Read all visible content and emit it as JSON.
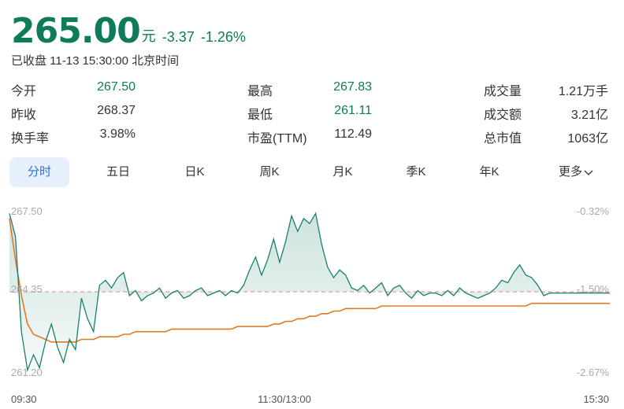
{
  "header": {
    "price": "265.00",
    "unit": "元",
    "change": "-3.37",
    "change_pct": "-1.26%",
    "status": "已收盘 11-13 15:30:00 北京时间"
  },
  "stats": {
    "open": {
      "label": "今开",
      "value": "267.50"
    },
    "prev_close": {
      "label": "昨收",
      "value": "268.37"
    },
    "turnover_rate": {
      "label": "换手率",
      "value": "3.98%"
    },
    "high": {
      "label": "最高",
      "value": "267.83"
    },
    "low": {
      "label": "最低",
      "value": "261.11"
    },
    "pe_ttm": {
      "label": "市盈(TTM)",
      "value": "112.49"
    },
    "volume": {
      "label": "成交量",
      "value": "1.21万手"
    },
    "amount": {
      "label": "成交额",
      "value": "3.21亿"
    },
    "market_cap": {
      "label": "总市值",
      "value": "1063亿"
    }
  },
  "tabs": [
    {
      "label": "分时"
    },
    {
      "label": "五日"
    },
    {
      "label": "日K"
    },
    {
      "label": "周K"
    },
    {
      "label": "月K"
    },
    {
      "label": "季K"
    },
    {
      "label": "年K"
    },
    {
      "label": "更多"
    }
  ],
  "colors": {
    "accent_green": "#0f7b5a",
    "price_line": "#1a7f6b",
    "avg_line": "#e07a24",
    "ref_line": "#e99a9a",
    "tab_active_bg": "#e7f1fd",
    "tab_active_text": "#2f6fd6"
  },
  "chart_data": {
    "type": "line",
    "ylim": [
      261.2,
      267.5
    ],
    "y_tick_labels": [
      "267.50",
      "264.35",
      "261.20"
    ],
    "pct_tick_labels": [
      "-0.32%",
      "-1.50%",
      "-2.67%"
    ],
    "reference_price": 264.35,
    "x_tick_labels": [
      "09:30",
      "11:30/13:00",
      "15:30"
    ],
    "x_range": [
      0,
      100
    ],
    "series": [
      {
        "x": [
          0,
          1,
          2,
          3,
          4,
          5,
          6,
          7,
          8,
          9,
          10,
          11,
          12,
          13,
          14,
          15,
          16,
          17,
          18,
          19,
          20,
          21,
          22,
          23,
          24,
          25,
          26,
          27,
          28,
          29,
          30,
          31,
          32,
          33,
          34,
          35,
          36,
          37,
          38,
          39,
          40,
          41,
          42,
          43,
          44,
          45,
          46,
          47,
          48,
          49,
          50,
          51,
          52,
          53,
          54,
          55,
          56,
          57,
          58,
          59,
          60,
          61,
          62,
          63,
          64,
          65,
          66,
          67,
          68,
          69,
          70,
          71,
          72,
          73,
          74,
          75,
          76,
          77,
          78,
          79,
          80,
          81,
          82,
          83,
          84,
          85,
          86,
          87,
          88,
          89,
          90,
          91,
          92,
          93,
          94,
          95,
          96,
          97,
          98,
          99,
          100
        ],
        "values": [
          267.4,
          266.5,
          262.8,
          261.3,
          261.9,
          261.4,
          262.4,
          263.1,
          262.2,
          261.6,
          262.5,
          262.1,
          264.1,
          263.3,
          262.8,
          264.6,
          264.8,
          264.5,
          264.9,
          265.1,
          264.2,
          264.4,
          264.0,
          264.2,
          264.3,
          264.5,
          264.1,
          264.3,
          264.4,
          264.1,
          264.2,
          264.4,
          264.5,
          264.2,
          264.3,
          264.4,
          264.2,
          264.4,
          264.3,
          264.6,
          265.2,
          265.7,
          265.0,
          265.6,
          266.4,
          265.5,
          266.3,
          267.3,
          266.7,
          267.2,
          267.0,
          267.4,
          266.2,
          265.3,
          264.9,
          265.2,
          265.0,
          264.5,
          264.4,
          264.6,
          264.3,
          264.5,
          264.7,
          264.2,
          264.5,
          264.6,
          264.3,
          264.1,
          264.4,
          264.2,
          264.3,
          264.3,
          264.2,
          264.4,
          264.2,
          264.5,
          264.3,
          264.2,
          264.1,
          264.2,
          264.3,
          264.5,
          264.8,
          264.7,
          265.1,
          265.4,
          265.0,
          264.9,
          264.6,
          264.2,
          264.3,
          264.3,
          264.3,
          264.3,
          264.3,
          264.3,
          264.3,
          264.3,
          264.3,
          264.3,
          264.3
        ]
      },
      {
        "x": [
          0,
          1,
          2,
          3,
          4,
          5,
          6,
          7,
          8,
          9,
          10,
          11,
          12,
          13,
          14,
          15,
          16,
          17,
          18,
          19,
          20,
          21,
          22,
          23,
          24,
          25,
          26,
          27,
          28,
          29,
          30,
          31,
          32,
          33,
          34,
          35,
          36,
          37,
          38,
          39,
          40,
          41,
          42,
          43,
          44,
          45,
          46,
          47,
          48,
          49,
          50,
          51,
          52,
          53,
          54,
          55,
          56,
          57,
          58,
          59,
          60,
          61,
          62,
          63,
          64,
          65,
          66,
          67,
          68,
          69,
          70,
          71,
          72,
          73,
          74,
          75,
          76,
          77,
          78,
          79,
          80,
          81,
          82,
          83,
          84,
          85,
          86,
          87,
          88,
          89,
          90,
          91,
          92,
          93,
          94,
          95,
          96,
          97,
          98,
          99,
          100
        ],
        "values": [
          267.2,
          265.6,
          264.2,
          263.1,
          262.7,
          262.6,
          262.5,
          262.4,
          262.4,
          262.4,
          262.4,
          262.4,
          262.5,
          262.5,
          262.5,
          262.6,
          262.6,
          262.6,
          262.6,
          262.7,
          262.7,
          262.8,
          262.8,
          262.8,
          262.8,
          262.8,
          262.8,
          262.9,
          262.9,
          262.9,
          262.9,
          262.9,
          262.9,
          262.9,
          262.9,
          262.9,
          262.9,
          262.9,
          263.0,
          263.0,
          263.0,
          263.0,
          263.0,
          263.0,
          263.1,
          263.1,
          263.2,
          263.2,
          263.3,
          263.3,
          263.4,
          263.4,
          263.5,
          263.5,
          263.6,
          263.6,
          263.7,
          263.7,
          263.7,
          263.7,
          263.7,
          263.7,
          263.8,
          263.8,
          263.8,
          263.8,
          263.8,
          263.8,
          263.8,
          263.8,
          263.8,
          263.8,
          263.8,
          263.8,
          263.8,
          263.8,
          263.8,
          263.8,
          263.8,
          263.8,
          263.8,
          263.8,
          263.8,
          263.8,
          263.8,
          263.8,
          263.8,
          263.9,
          263.9,
          263.9,
          263.9,
          263.9,
          263.9,
          263.9,
          263.9,
          263.9,
          263.9,
          263.9,
          263.9,
          263.9,
          263.9
        ]
      }
    ]
  }
}
